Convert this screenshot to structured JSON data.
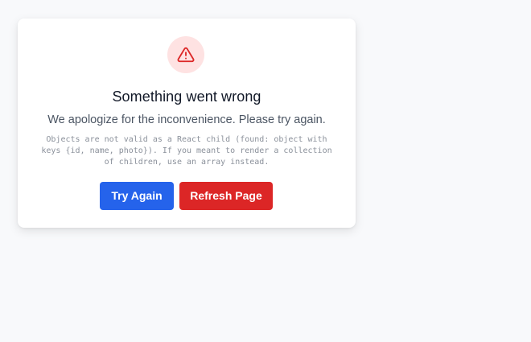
{
  "error_card": {
    "icon": "warning-triangle-icon",
    "title": "Something went wrong",
    "subtitle": "We apologize for the inconvenience. Please try again.",
    "error_message": "Objects are not valid as a React child (found: object with keys {id, name, photo}). If you meant to render a collection of children, use an array instead.",
    "buttons": {
      "try_again": "Try Again",
      "refresh_page": "Refresh Page"
    }
  },
  "colors": {
    "primary": "#2563eb",
    "danger": "#dc2626",
    "icon_bg": "#fee2e2",
    "icon_stroke": "#dc2626",
    "page_bg": "#f8f9fb"
  }
}
